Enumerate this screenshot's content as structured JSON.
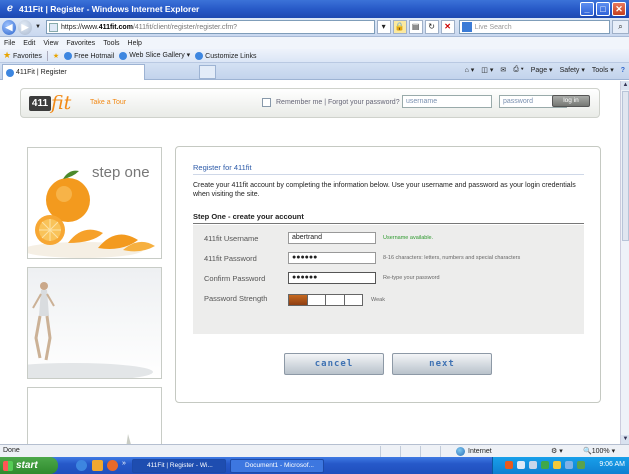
{
  "window": {
    "title": "411Fit | Register - Windows Internet Explorer",
    "controls": [
      "_",
      "□",
      "✕"
    ]
  },
  "address_bar": {
    "url_prefix": "https://www.",
    "url_domain": "411fit.com",
    "url_path": "/411fit/client/register/register.cfm?",
    "search_placeholder": "Live Search"
  },
  "menu": [
    "File",
    "Edit",
    "View",
    "Favorites",
    "Tools",
    "Help"
  ],
  "favorites_bar": {
    "label": "Favorites",
    "items": [
      "Free Hotmail",
      "Web Slice Gallery",
      "Customize Links"
    ]
  },
  "tab": {
    "label": "411Fit | Register"
  },
  "command_bar": [
    "Page",
    "Safety",
    "Tools"
  ],
  "site_header": {
    "logo_box": "411",
    "logo_script": "fit",
    "take_tour": "Take a Tour",
    "remember_text": "Remember me  |  Forgot your password?",
    "username_placeholder": "username",
    "password_placeholder": "password",
    "login_label": "log in"
  },
  "left_panels": {
    "step_label": "step one"
  },
  "form": {
    "title": "Register for 411fit",
    "description": "Create your 411fit account by completing the information below. Use your username and password as your login credentials when visiting the site.",
    "step_title": "Step One - create your account",
    "fields": [
      {
        "label": "411fit Username",
        "value": "abertrand",
        "hint": "Username available."
      },
      {
        "label": "411fit Password",
        "value": "●●●●●●",
        "hint": "8-16 characters: letters, numbers and special characters"
      },
      {
        "label": "Confirm Password",
        "value": "●●●●●●",
        "hint": "Re-type your password"
      }
    ],
    "strength": {
      "label": "Password Strength",
      "level": 1,
      "segments": 4,
      "text": "Weak"
    },
    "cancel_label": "cancel",
    "next_label": "next"
  },
  "status_bar": {
    "status": "Done",
    "zone": "Internet",
    "zoom": "100%"
  },
  "taskbar": {
    "start_label": "start",
    "tasks": [
      "411Fit | Register - Wi...",
      "Document1 - Microsof..."
    ],
    "clock": "9:06 AM"
  },
  "colors": {
    "brand_orange": "#f28a17",
    "link_blue": "#2c5aa8",
    "ok_green": "#2f9a2f",
    "strength_fill": "#a84e17"
  }
}
